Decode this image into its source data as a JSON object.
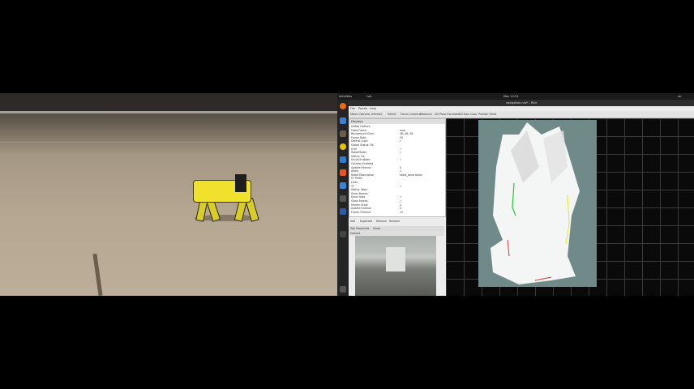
{
  "video": {
    "description_icons": "robot-dog"
  },
  "desktop": {
    "topbar": {
      "left": "Activities",
      "app": "rviz",
      "clock": "Mon 12:51",
      "right": "en"
    },
    "dock_icons": [
      "firefox-icon",
      "files-icon",
      "terminal-icon",
      "rhythmbox-icon",
      "writer-icon",
      "software-icon",
      "help-icon",
      "settings-icon",
      "apps-icon"
    ]
  },
  "rviz": {
    "title": "navigation.rviz* - RViz",
    "menu": [
      "File",
      "Panels",
      "Help"
    ],
    "toolbar": [
      "Move Camera",
      "Interact",
      "Select",
      "Focus Camera",
      "Measure",
      "2D Pose Estimate",
      "2D Nav Goal",
      "Publish Point"
    ],
    "displays_title": "Displays",
    "displays": [
      {
        "name": "Global Options",
        "value": ""
      },
      {
        "name": "Fixed Frame",
        "value": "map"
      },
      {
        "name": "Background Color",
        "value": "48; 48; 48"
      },
      {
        "name": "Frame Rate",
        "value": "30"
      },
      {
        "name": "Default Light",
        "value": "✓"
      },
      {
        "name": "Global Status: Ok",
        "value": ""
      },
      {
        "name": "Grid",
        "value": "✓"
      },
      {
        "name": "RobotModel",
        "value": "✓"
      },
      {
        "name": "Status: Ok",
        "value": ""
      },
      {
        "name": "Visual Enabled",
        "value": "✓"
      },
      {
        "name": "Collision Enabled",
        "value": ""
      },
      {
        "name": "Update Interval",
        "value": "0"
      },
      {
        "name": "Alpha",
        "value": "1"
      },
      {
        "name": "Robot Description",
        "value": "robot_description"
      },
      {
        "name": "TF Prefix",
        "value": ""
      },
      {
        "name": "Links",
        "value": ""
      },
      {
        "name": "TF",
        "value": "✓"
      },
      {
        "name": "Status: Warn",
        "value": ""
      },
      {
        "name": "Show Names",
        "value": ""
      },
      {
        "name": "Show Axes",
        "value": "✓"
      },
      {
        "name": "Show Arrows",
        "value": "✓"
      },
      {
        "name": "Marker Scale",
        "value": "1"
      },
      {
        "name": "Update Interval",
        "value": "0"
      },
      {
        "name": "Frame Timeout",
        "value": "15"
      }
    ],
    "panel_buttons": [
      "Add",
      "Duplicate",
      "Remove",
      "Rename"
    ],
    "panel_tabs": [
      "Tool Properties",
      "Views"
    ],
    "camera_title": "Camera"
  }
}
